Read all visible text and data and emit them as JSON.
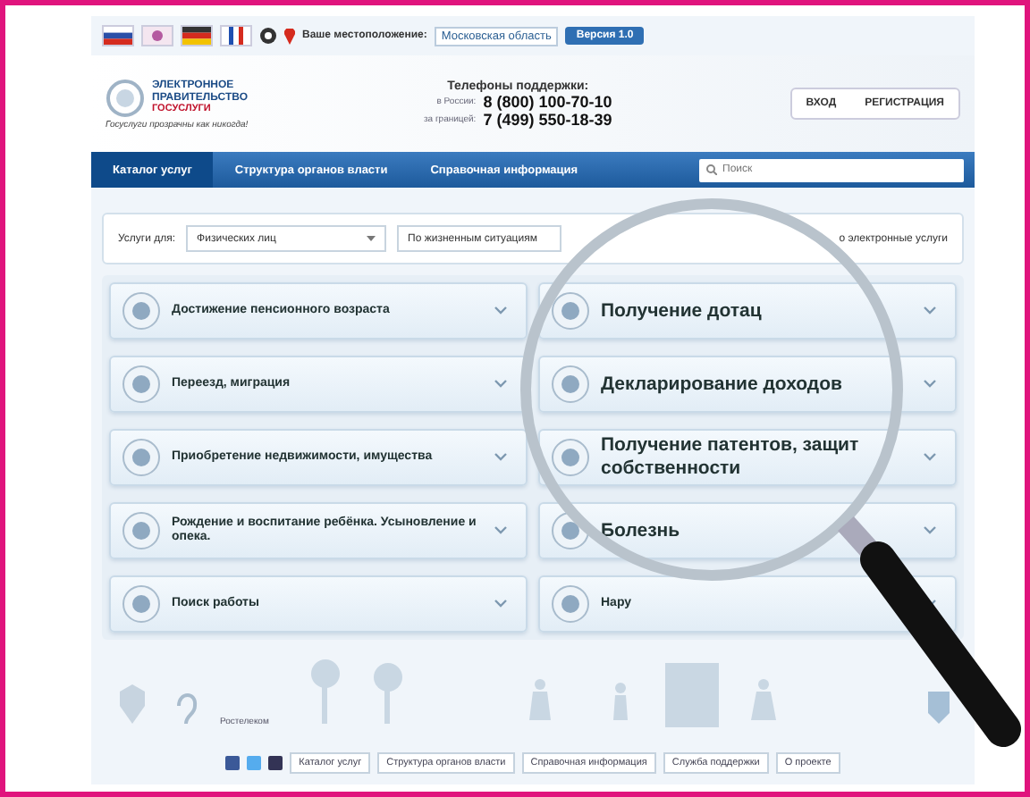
{
  "top_bar": {
    "location_label": "Ваше местоположение:",
    "location_value": "Московская область",
    "version_button": "Версия 1.0"
  },
  "header": {
    "logo_title": "ЭЛЕКТРОННОЕ ПРАВИТЕЛЬСТВО",
    "logo_subtitle": "ГОСУСЛУГИ",
    "tagline": "Госуслуги прозрачны как никогда!",
    "phones_title": "Телефоны поддержки:",
    "phones": [
      {
        "label": "в России:",
        "number": "8 (800) 100-70-10"
      },
      {
        "label": "за границей:",
        "number": "7 (499) 550-18-39"
      }
    ],
    "buttons": [
      "ВХОД",
      "РЕГИСТРАЦИЯ"
    ]
  },
  "nav": {
    "tabs": [
      {
        "label": "Каталог услуг",
        "selected": true
      },
      {
        "label": "Структура органов власти",
        "selected": false
      },
      {
        "label": "Справочная информация",
        "selected": false
      }
    ],
    "search": {
      "placeholder": "Поиск"
    }
  },
  "filter": {
    "label": "Услуги для:",
    "audience": "Физических лиц",
    "grouping": "По жизненным ситуациям",
    "electronic_only": "о электронные услуги"
  },
  "left_cards": [
    {
      "label": "Достижение пенсионного возраста",
      "kind": "normal"
    },
    {
      "label": "Переезд, миграция",
      "kind": "normal"
    },
    {
      "label": "Приобретение недвижимости, имущества",
      "kind": "normal"
    },
    {
      "label": "Рождение и воспитание ребёнка. Усыновление и опека.",
      "kind": "normal"
    },
    {
      "label": "Поиск работы",
      "kind": "normal"
    }
  ],
  "right_cards": [
    {
      "label": "Получение дотац",
      "kind": "magnified"
    },
    {
      "label": "Декларирование доходов",
      "kind": "magnified"
    },
    {
      "label": "Получение патентов, защит собственности",
      "kind": "magnified"
    },
    {
      "label": "Болезнь",
      "kind": "magnified"
    },
    {
      "label": "Нару",
      "kind": "normal"
    }
  ],
  "footer": {
    "partner": "Ростелеком",
    "links": [
      "Каталог услуг",
      "Структура органов власти",
      "Справочная информация",
      "Служба поддержки",
      "О проекте"
    ]
  }
}
